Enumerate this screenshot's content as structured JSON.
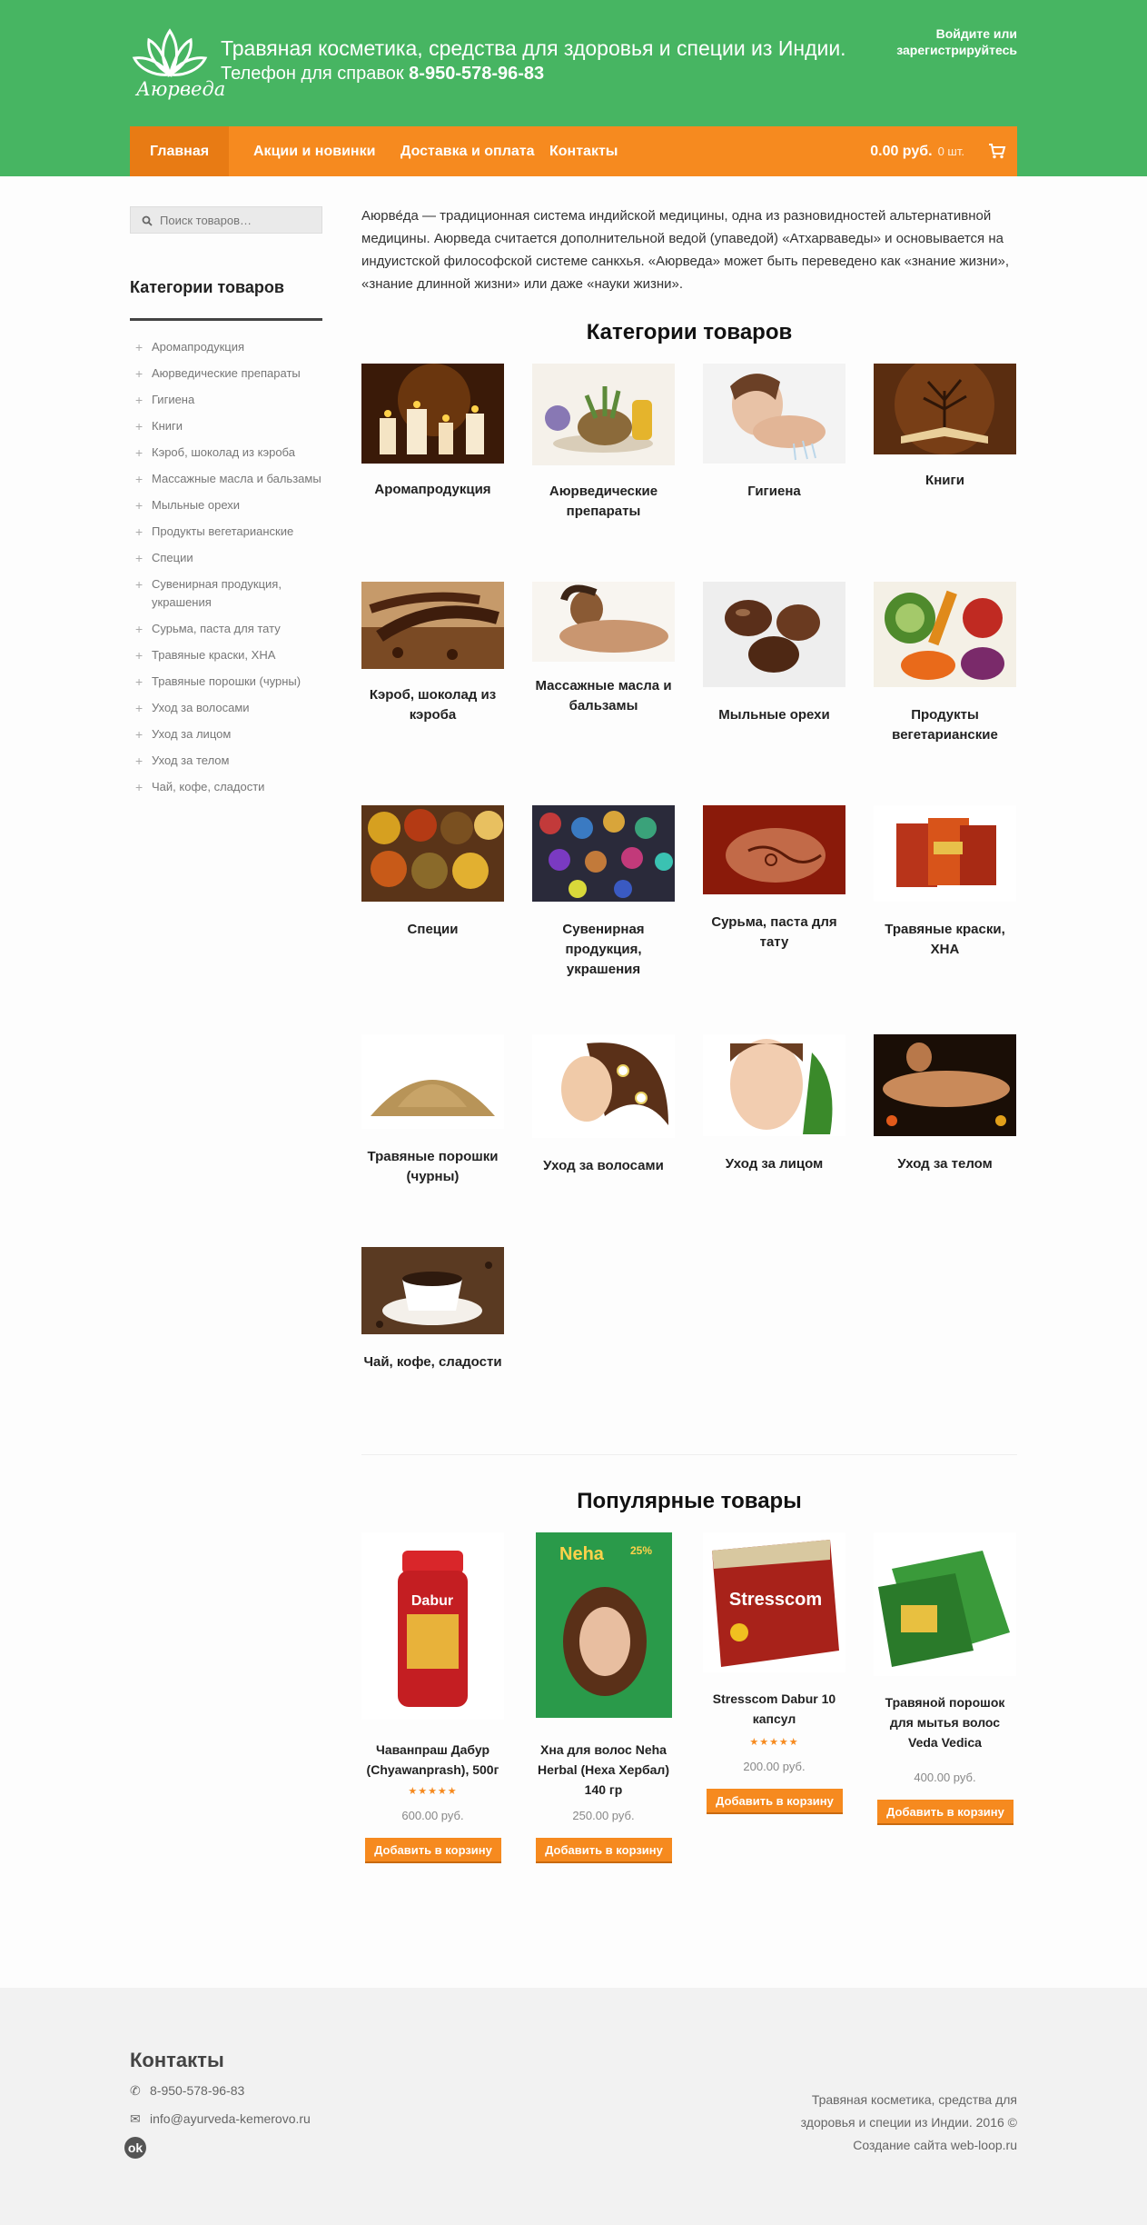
{
  "header": {
    "logo_text": "Аюрведа",
    "title": "Травяная косметика, средства для здоровья и специи из Индии.",
    "phone_prefix": "Телефон для справок",
    "phone": "8-950-578-96-83",
    "login_line1": "Войдите или",
    "login_line2": "зарегистрируйтесь"
  },
  "nav": {
    "items": [
      "Главная",
      "Акции и новинки",
      "Доставка и оплата",
      "Контакты"
    ],
    "cart_total": "0.00 руб.",
    "cart_count": "0 шт."
  },
  "search": {
    "placeholder": "Поиск товаров…"
  },
  "sidebar": {
    "title": "Категории товаров",
    "items": [
      "Аромапродукция",
      "Аюрведические препараты",
      "Гигиена",
      "Книги",
      "Кэроб, шоколад из кэроба",
      "Массажные масла и бальзамы",
      "Мыльные орехи",
      "Продукты вегетарианские",
      "Специи",
      "Сувенирная продукция, украшения",
      "Сурьма, паста для тату",
      "Травяные краски, ХНА",
      "Травяные порошки (чурны)",
      "Уход за волосами",
      "Уход за лицом",
      "Уход за телом",
      "Чай, кофе, сладости"
    ]
  },
  "intro": "Аюрве́да — традиционная система индийской медицины, одна из разновидностей альтернативной медицины. Аюрведа считается дополнительной ведой (упаведой) «Атхарваведы» и основывается на индуистской философской системе санкхья. «Аюрведа» может быть переведено как «знание жизни», «знание длинной жизни» или даже «науки жизни».",
  "categories_title": "Категории товаров",
  "categories": [
    "Аромапродукция",
    "Аюрведические препараты",
    "Гигиена",
    "Книги",
    "Кэроб, шоколад из кэроба",
    "Массажные масла и бальзамы",
    "Мыльные орехи",
    "Продукты вегетарианские",
    "Специи",
    "Сувенирная продукция, украшения",
    "Сурьма, паста для тату",
    "Травяные краски, ХНА",
    "Травяные порошки (чурны)",
    "Уход за волосами",
    "Уход за лицом",
    "Уход за телом",
    "Чай, кофе, сладости"
  ],
  "popular_title": "Популярные товары",
  "products": [
    {
      "name": "Чаванпраш Дабур (Chyawanprash), 500г",
      "price": "600.00 руб.",
      "rating": 5,
      "button": "Добавить в корзину"
    },
    {
      "name": "Хна для волос Neha Herbal (Неха Хербал) 140 гр",
      "price": "250.00 руб.",
      "rating": 0,
      "button": "Добавить в корзину"
    },
    {
      "name": "Stresscom Dabur 10 капсул",
      "price": "200.00 руб.",
      "rating": 5,
      "button": "Добавить в корзину"
    },
    {
      "name": "Травяной порошок для мытья волос Veda Vedica",
      "price": "400.00 руб.",
      "rating": 0,
      "button": "Добавить в корзину"
    }
  ],
  "footer": {
    "title": "Контакты",
    "phone": "8-950-578-96-83",
    "email": "info@ayurveda-kemerovo.ru",
    "right_line1": "Травяная косметика, средства для",
    "right_line2": "здоровья и специи из Индии. 2016 ©",
    "right_line3": "Создание сайта web-loop.ru"
  },
  "colors": {
    "header": "#47b562",
    "accent": "#f68a1f"
  }
}
